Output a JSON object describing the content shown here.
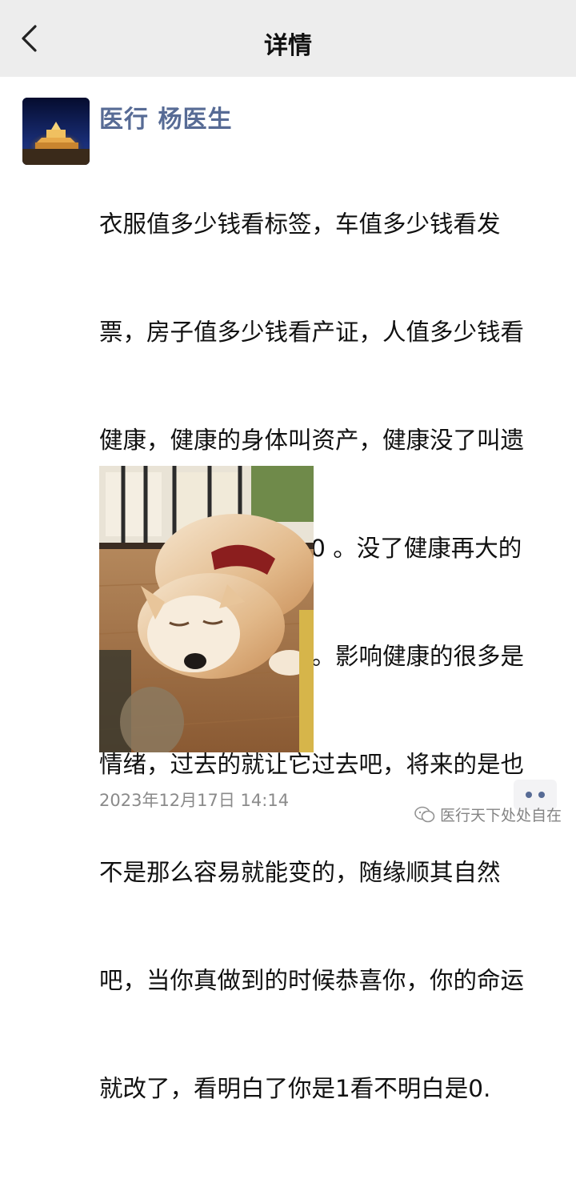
{
  "header": {
    "title": "详情",
    "back_icon": "chevron-left-icon"
  },
  "post": {
    "author": "医行 杨医生",
    "content_lines": [
      "衣服值多少钱看标签，车值多少钱看发",
      "票，房子值多少钱看产证，人值多少钱看",
      "健康，健康的身体叫资产，健康没了叫遗",
      "产。健康是1 其他是0 。没了健康再大的",
      "老板再大的官都是零。影响健康的很多是",
      "情绪，过去的就让它过去吧，将来的是也",
      "不是那么容易就能变的，随缘顺其自然",
      "吧，当你真做到的时候恭喜你，你的命运",
      "就改了，看明白了你是1看不明白是0."
    ],
    "timestamp": "2023年12月17日 14:14",
    "more_icon": "more-dots-icon"
  },
  "watermark": {
    "text": "医行天下处处自在",
    "icon": "wechat-logo-icon"
  },
  "colors": {
    "nav_bg": "#ededed",
    "author_link": "#576b95",
    "timestamp": "#8a8a8a"
  }
}
